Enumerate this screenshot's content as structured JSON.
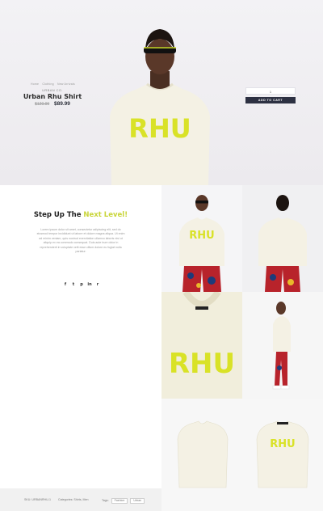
{
  "breadcrumb": [
    "Home",
    "Clothing",
    "New Arrivals"
  ],
  "product": {
    "brand": "URBAN CO.",
    "title": "Urban Rhu Shirt",
    "old_price": "$120.99",
    "price": "$89.99",
    "quantity": "1",
    "add_to_cart": "ADD TO CART"
  },
  "story": {
    "title_start": "Step Up The ",
    "title_accent": "Next Level!",
    "body": "Lorem ipsum dolor sit amet, consectetur adipiscing elit, sed do eiusmod tempor incididunt ut labore et dolore magna aliqua. Ut enim ad minim veniam, quis nostrud exercitation ullamco laboris nisi ut aliquip ex ea commodo consequat. Duis aute irure dolor in reprehenderit in voluptate velit esse cillum dolore eu fugiat nulla pariatur.",
    "social": [
      "f",
      "t",
      "p",
      "in",
      "r"
    ]
  },
  "meta": {
    "sku": "SKU: URBANRHU-1",
    "categories": "Categories: Shirts, Men",
    "tags_label": "Tags:",
    "tags": [
      "Fashion",
      "Urban"
    ]
  },
  "colors": {
    "accent": "#c9d53a",
    "button": "#2d3142",
    "shirt": "#f4f1e4",
    "print": "#d9e227"
  }
}
